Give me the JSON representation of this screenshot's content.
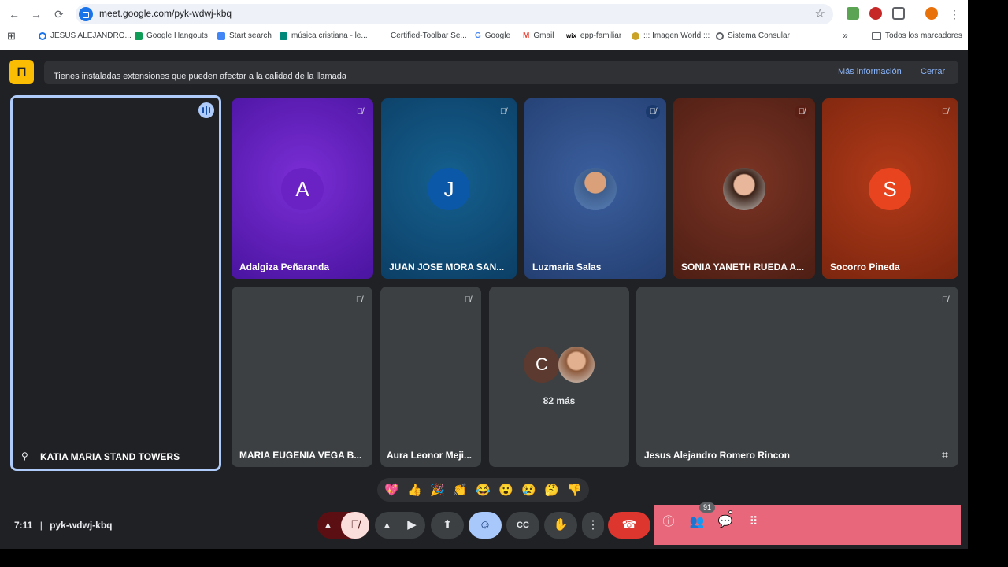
{
  "browser": {
    "url": "meet.google.com/pyk-wdwj-kbq",
    "bookmarks": [
      {
        "label": "JESUS ALEJANDRO...",
        "color": "#1a73e8"
      },
      {
        "label": "Google Hangouts",
        "color": "#0f9d58"
      },
      {
        "label": "Start search",
        "color": "#4285f4"
      },
      {
        "label": "música cristiana - le...",
        "color": "#00897b"
      },
      {
        "label": "Certified-Toolbar Se...",
        "color": "#ffffff"
      },
      {
        "label": "Google",
        "color": "#ea4335"
      },
      {
        "label": "Gmail",
        "color": "#ea4335"
      },
      {
        "label": "epp-familiar",
        "color": "#000000"
      },
      {
        "label": "::: Imagen World :::",
        "color": "#c9a227"
      },
      {
        "label": "Sistema Consular",
        "color": "#5f6368"
      }
    ],
    "all_bookmarks_label": "Todos los marcadores"
  },
  "banner": {
    "text": "Tienes instaladas extensiones que pueden afectar a la calidad de la llamada",
    "more_info": "Más información",
    "close": "Cerrar"
  },
  "participants": {
    "speaker": {
      "name": "KATIA MARIA STAND TOWERS"
    },
    "tiles": [
      {
        "name": "Adalgiza Peñaranda",
        "initial": "A",
        "avatar_color": "#6a1fb8",
        "bg": "#5b1fb0"
      },
      {
        "name": "JUAN JOSE MORA SAN...",
        "initial": "J",
        "avatar_color": "#0b57a8",
        "bg": "#0d4f80"
      },
      {
        "name": "Luzmaria Salas",
        "photo": true,
        "bg": "#2e4e86"
      },
      {
        "name": "SONIA YANETH RUEDA A...",
        "photo": true,
        "bg": "#6e2a1d"
      },
      {
        "name": "Socorro Pineda",
        "initial": "S",
        "avatar_color": "#e8441f",
        "bg": "#9c2f14"
      },
      {
        "name": "MARIA EUGENIA VEGA B..."
      },
      {
        "name": "Aura Leonor Meji..."
      },
      {
        "name": "Jesus Alejandro Romero Rincon"
      }
    ],
    "others": {
      "initial": "C",
      "label": "82 más"
    }
  },
  "reactions": [
    "💖",
    "👍",
    "🎉",
    "👏",
    "😂",
    "😮",
    "😢",
    "🤔",
    "👎"
  ],
  "footer": {
    "time": "7:11",
    "separator": "|",
    "meeting_code": "pyk-wdwj-kbq",
    "people_count": "91"
  }
}
